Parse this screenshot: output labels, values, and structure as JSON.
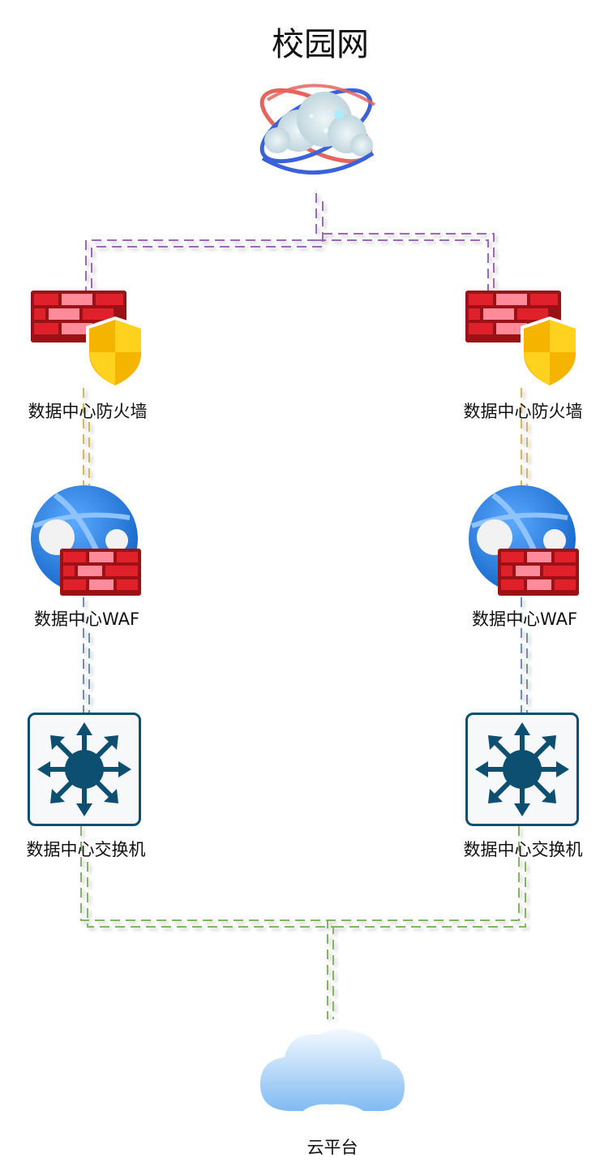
{
  "title": "校园网",
  "nodes": {
    "campus_network_icon": "globe-orbit-icon",
    "firewall_left": {
      "label": "数据中心防火墙",
      "icon": "firewall-shield-icon"
    },
    "firewall_right": {
      "label": "数据中心防火墙",
      "icon": "firewall-shield-icon"
    },
    "waf_left": {
      "label": "数据中心WAF",
      "icon": "web-firewall-icon"
    },
    "waf_right": {
      "label": "数据中心WAF",
      "icon": "web-firewall-icon"
    },
    "switch_left": {
      "label": "数据中心交换机",
      "icon": "network-switch-icon"
    },
    "switch_right": {
      "label": "数据中心交换机",
      "icon": "network-switch-icon"
    },
    "cloud": {
      "label": "云平台",
      "icon": "cloud-icon"
    }
  },
  "colors": {
    "link_top": "#9b6bb5",
    "link_firewall_waf": "#d6b656",
    "link_waf_switch": "#6c8ebf",
    "link_bottom": "#82b366",
    "brick_red": "#e0202a",
    "brick_light": "#ff8a9a",
    "shield_yellow": "#ffd21f",
    "globe_blue": "#1f78d8",
    "switch_blue": "#0d4f70",
    "cloud_blue": "#8fc5f5"
  }
}
